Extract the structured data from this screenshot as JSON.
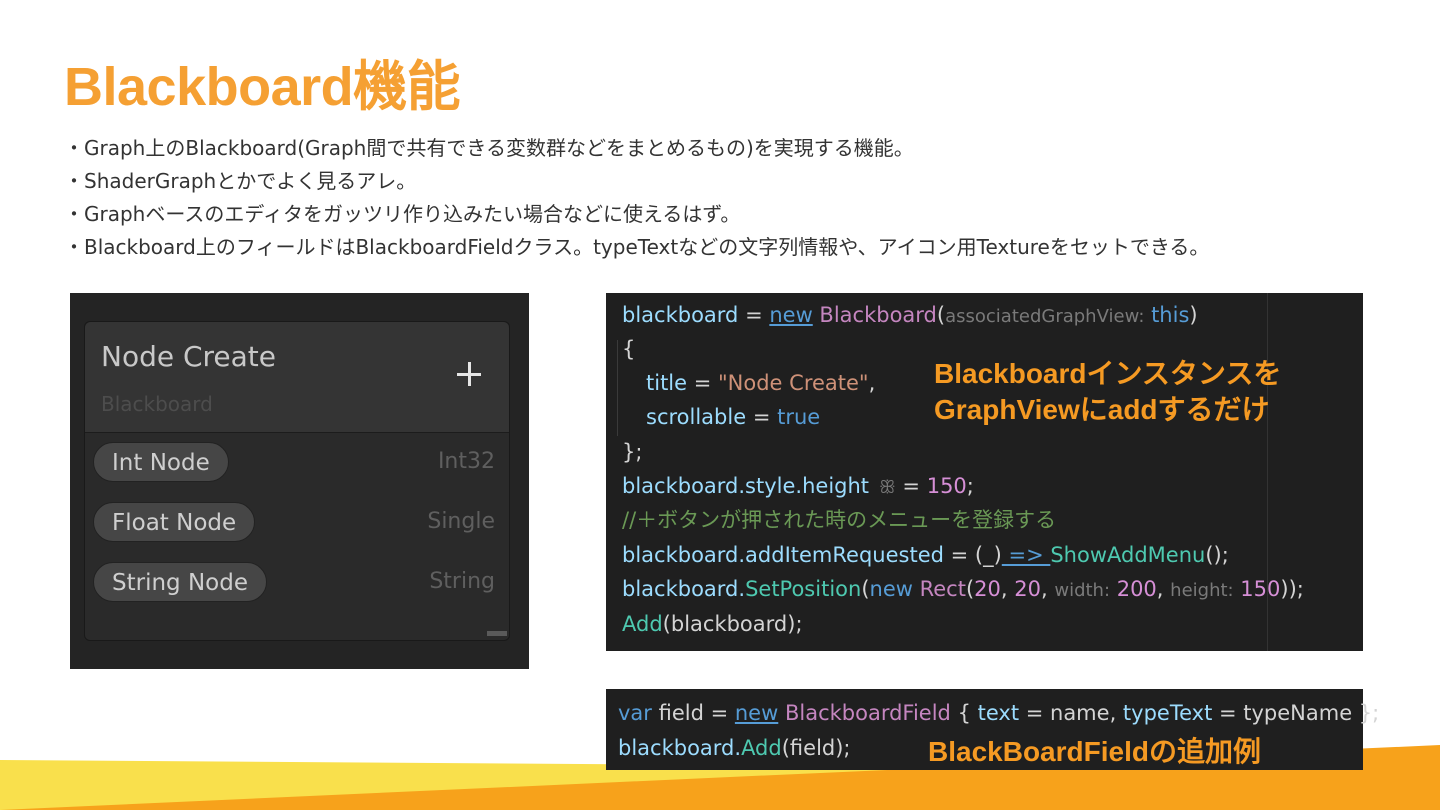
{
  "colors": {
    "accent": "#f5a033",
    "band_orange": "#f7a21b",
    "band_yellow": "#f9e04c"
  },
  "slide": {
    "title": "Blackboard機能",
    "bullets": [
      "・Graph上のBlackboard(Graph間で共有できる変数群などをまとめるもの)を実現する機能。",
      "・ShaderGraphとかでよく見るアレ。",
      "・Graphベースのエディタをガッツリ作り込みたい場合などに使えるはず。",
      "・Blackboard上のフィールドはBlackboardFieldクラス。typeTextなどの文字列情報や、アイコン用Textureをセットできる。"
    ]
  },
  "blackboard": {
    "title": "Node Create",
    "subtitle": "Blackboard",
    "add_icon": "plus-icon",
    "fields": [
      {
        "name": "Int Node",
        "type": "Int32"
      },
      {
        "name": "Float Node",
        "type": "Single"
      },
      {
        "name": "String Node",
        "type": "String"
      }
    ]
  },
  "code1": {
    "l1": {
      "a": "blackboard",
      "b": " = ",
      "c": "new",
      "d": " Blackboard",
      "e": "(",
      "f": "associatedGraphView:",
      "g": " this",
      "h": ")"
    },
    "l2": "{",
    "l3": {
      "a": "title",
      "b": " = ",
      "c": "\"Node Create\"",
      "d": ","
    },
    "l4": {
      "a": "scrollable",
      "b": " = ",
      "c": "true"
    },
    "l5": "};",
    "l6": {
      "a": "blackboard.style.height",
      "b": "ꕥ",
      "c": " = ",
      "d": "150",
      "e": ";"
    },
    "l7": "//＋ボタンが押された時のメニューを登録する",
    "l8": {
      "a": "blackboard.addItemRequested",
      "b": " = ",
      "c": "(_)",
      "d": " => ",
      "e": "ShowAddMenu",
      "f": "();"
    },
    "l9": {
      "a": "blackboard.",
      "b": "SetPosition",
      "c": "(",
      "d": "new",
      "e": " Rect",
      "f": "(",
      "g": "20",
      "h": ", ",
      "i": "20",
      "j": ", ",
      "k": "width:",
      "l": " 200",
      "m": ", ",
      "n": "height:",
      "o": " 150",
      "p": "));"
    },
    "l10": {
      "a": "Add",
      "b": "(blackboard);"
    }
  },
  "code2": {
    "l1": {
      "a": "var",
      "b": " field = ",
      "c": "new",
      "d": " BlackboardField",
      "e": " { ",
      "f": "text",
      "g": " = name, ",
      "h": "typeText",
      "i": " = typeName };"
    },
    "l2": {
      "a": "blackboard.",
      "b": "Add",
      "c": "(field);"
    }
  },
  "callouts": {
    "code1_line1": "Blackboardインスタンスを",
    "code1_line2": "GraphViewにaddするだけ",
    "code2": "BlackBoardFieldの追加例"
  }
}
